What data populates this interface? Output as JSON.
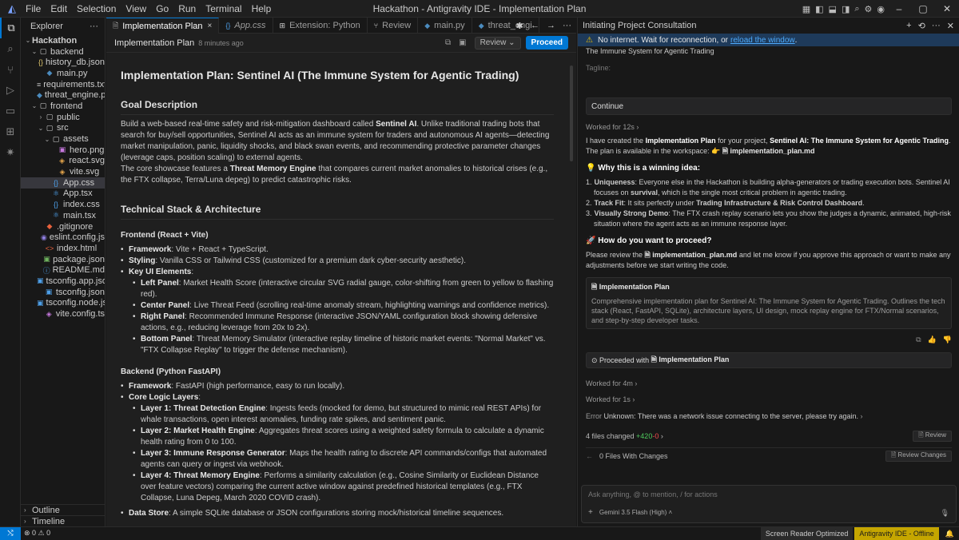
{
  "menu": [
    "File",
    "Edit",
    "Selection",
    "View",
    "Go",
    "Run",
    "Terminal",
    "Help"
  ],
  "window_title": "Hackathon - Antigravity IDE - Implementation Plan",
  "explorer": {
    "title": "Explorer",
    "more": "···",
    "items": [
      {
        "label": "Hackathon",
        "depth": 0,
        "chev": "⌄",
        "icon": "",
        "color": "#cccccc",
        "sel": false,
        "bold": true
      },
      {
        "label": "backend",
        "depth": 1,
        "chev": "⌄",
        "icon": "▢",
        "color": "#cccccc",
        "sel": false
      },
      {
        "label": "history_db.json",
        "depth": 2,
        "chev": "",
        "icon": "{}",
        "color": "#d8c06a",
        "sel": false
      },
      {
        "label": "main.py",
        "depth": 2,
        "chev": "",
        "icon": "◆",
        "color": "#4b8bbe",
        "sel": false
      },
      {
        "label": "requirements.txt",
        "depth": 2,
        "chev": "",
        "icon": "≡",
        "color": "#bbbbbb",
        "sel": false
      },
      {
        "label": "threat_engine.py",
        "depth": 2,
        "chev": "",
        "icon": "◆",
        "color": "#4b8bbe",
        "sel": false
      },
      {
        "label": "frontend",
        "depth": 1,
        "chev": "⌄",
        "icon": "▢",
        "color": "#cccccc",
        "sel": false
      },
      {
        "label": "public",
        "depth": 2,
        "chev": "›",
        "icon": "▢",
        "color": "#cccccc",
        "sel": false
      },
      {
        "label": "src",
        "depth": 2,
        "chev": "⌄",
        "icon": "▢",
        "color": "#cccccc",
        "sel": false
      },
      {
        "label": "assets",
        "depth": 3,
        "chev": "⌄",
        "icon": "▢",
        "color": "#cccccc",
        "sel": false
      },
      {
        "label": "hero.png",
        "depth": 4,
        "chev": "",
        "icon": "▣",
        "color": "#c678dd",
        "sel": false
      },
      {
        "label": "react.svg",
        "depth": 4,
        "chev": "",
        "icon": "◈",
        "color": "#e5a54b",
        "sel": false
      },
      {
        "label": "vite.svg",
        "depth": 4,
        "chev": "",
        "icon": "◈",
        "color": "#e5a54b",
        "sel": false
      },
      {
        "label": "App.css",
        "depth": 3,
        "chev": "",
        "icon": "{}",
        "color": "#4d9fe8",
        "sel": true
      },
      {
        "label": "App.tsx",
        "depth": 3,
        "chev": "",
        "icon": "⚛",
        "color": "#4d9fe8",
        "sel": false
      },
      {
        "label": "index.css",
        "depth": 3,
        "chev": "",
        "icon": "{}",
        "color": "#4d9fe8",
        "sel": false
      },
      {
        "label": "main.tsx",
        "depth": 3,
        "chev": "",
        "icon": "⚛",
        "color": "#4d9fe8",
        "sel": false
      },
      {
        "label": ".gitignore",
        "depth": 2,
        "chev": "",
        "icon": "◆",
        "color": "#e8613c",
        "sel": false
      },
      {
        "label": "eslint.config.js",
        "depth": 2,
        "chev": "",
        "icon": "◉",
        "color": "#8f7fe0",
        "sel": false
      },
      {
        "label": "index.html",
        "depth": 2,
        "chev": "",
        "icon": "<>",
        "color": "#e8613c",
        "sel": false
      },
      {
        "label": "package.json",
        "depth": 2,
        "chev": "",
        "icon": "▣",
        "color": "#6fb35f",
        "sel": false
      },
      {
        "label": "README.md",
        "depth": 2,
        "chev": "",
        "icon": "ⓘ",
        "color": "#4d9fe8",
        "sel": false
      },
      {
        "label": "tsconfig.app.json",
        "depth": 2,
        "chev": "",
        "icon": "▣",
        "color": "#4d9fe8",
        "sel": false
      },
      {
        "label": "tsconfig.json",
        "depth": 2,
        "chev": "",
        "icon": "▣",
        "color": "#4d9fe8",
        "sel": false
      },
      {
        "label": "tsconfig.node.json",
        "depth": 2,
        "chev": "",
        "icon": "▣",
        "color": "#4d9fe8",
        "sel": false
      },
      {
        "label": "vite.config.ts",
        "depth": 2,
        "chev": "",
        "icon": "◈",
        "color": "#c678dd",
        "sel": false
      }
    ],
    "outline": "Outline",
    "timeline": "Timeline"
  },
  "tabs": [
    {
      "label": "Implementation Plan",
      "active": true,
      "close": "×"
    },
    {
      "label": "App.css",
      "active": false,
      "close": ""
    },
    {
      "label": "Extension: Python",
      "active": false,
      "close": ""
    },
    {
      "label": "Review",
      "active": false,
      "close": ""
    },
    {
      "label": "main.py",
      "active": false,
      "close": ""
    },
    {
      "label": "threat_engi",
      "active": false,
      "close": ""
    }
  ],
  "doc_header": {
    "title": "Implementation Plan",
    "time": "8 minutes ago",
    "review": "Review ⌄",
    "proceed": "Proceed"
  },
  "doc": {
    "h1": "Implementation Plan: Sentinel AI (The Immune System for Agentic Trading)",
    "goal_h": "Goal Description",
    "goal_p1_a": "Build a web-based real-time safety and risk-mitigation dashboard called ",
    "goal_p1_b": "Sentinel AI",
    "goal_p1_c": ". Unlike traditional trading bots that search for buy/sell opportunities, Sentinel AI acts as an immune system for traders and autonomous AI agents—detecting market manipulation, panic, liquidity shocks, and black swan events, and recommending protective parameter changes (leverage caps, position scaling) to external agents.",
    "goal_p2_a": "The core showcase features a ",
    "goal_p2_b": "Threat Memory Engine",
    "goal_p2_c": " that compares current market anomalies to historical crises (e.g., the FTX collapse, Terra/Luna depeg) to predict catastrophic risks.",
    "tech_h": "Technical Stack & Architecture",
    "fe_h": "Frontend (React + Vite)",
    "fe_items": [
      {
        "k": "Framework",
        "v": ": Vite + React + TypeScript."
      },
      {
        "k": "Styling",
        "v": ": Vanilla CSS or Tailwind CSS (customized for a premium dark cyber-security aesthetic)."
      },
      {
        "k": "Key UI Elements",
        "v": ":"
      }
    ],
    "ui_items": [
      {
        "k": "Left Panel",
        "v": ": Market Health Score (interactive circular SVG radial gauge, color-shifting from green to yellow to flashing red)."
      },
      {
        "k": "Center Panel",
        "v": ": Live Threat Feed (scrolling real-time anomaly stream, highlighting warnings and confidence metrics)."
      },
      {
        "k": "Right Panel",
        "v": ": Recommended Immune Response (interactive JSON/YAML configuration block showing defensive actions, e.g., reducing leverage from 20x to 2x)."
      },
      {
        "k": "Bottom Panel",
        "v": ": Threat Memory Simulator (interactive replay timeline of historic market events: \"Normal Market\" vs. \"FTX Collapse Replay\" to trigger the defense mechanism)."
      }
    ],
    "be_h": "Backend (Python FastAPI)",
    "be_items": [
      {
        "k": "Framework",
        "v": ": FastAPI (high performance, easy to run locally)."
      },
      {
        "k": "Core Logic Layers",
        "v": ":"
      }
    ],
    "layer_items": [
      {
        "k": "Layer 1: Threat Detection Engine",
        "v": ": Ingests feeds (mocked for demo, but structured to mimic real REST APIs) for whale transactions, open interest anomalies, funding rate spikes, and sentiment panic."
      },
      {
        "k": "Layer 2: Market Health Engine",
        "v": ": Aggregates threat scores using a weighted safety formula to calculate a dynamic health rating from 0 to 100."
      },
      {
        "k": "Layer 3: Immune Response Generator",
        "v": ": Maps the health rating to discrete API commands/configs that automated agents can query or ingest via webhook."
      },
      {
        "k": "Layer 4: Threat Memory Engine",
        "v": ": Performs a similarity calculation (e.g., Cosine Similarity or Euclidean Distance over feature vectors) comparing the current active window against predefined historical templates (e.g., FTX Collapse, Luna Depeg, March 2020 COVID crash)."
      }
    ],
    "ds_k": "Data Store",
    "ds_v": ": A simple SQLite database or JSON configurations storing mock/historical timeline sequences."
  },
  "panel": {
    "title": "Initiating Project Consultation",
    "banner_a": "No internet. Wait for reconnection, or ",
    "banner_link": "reload the window",
    "banner_b": ".",
    "pending_1": "The Immune System for Agentic Trading",
    "pending_2": "Tagline:",
    "continue": "Continue",
    "worked_12": "Worked for 12s  ›",
    "p1_a": "I have created the ",
    "p1_b": "Implementation Plan",
    "p1_c": " for your project, ",
    "p1_d": "Sentinel AI: The Immune System for Agentic Trading",
    "p1_e": ".",
    "p2_a": "The plan is available in the workspace: 👉 ",
    "p2_file": "🗎 implementation_plan.md",
    "why_h": "💡 Why this is a winning idea:",
    "why_items": [
      {
        "n": "1.",
        "k": "Uniqueness",
        "v": ": Everyone else in the Hackathon is building alpha-generators or trading execution bots. Sentinel AI focuses on ",
        "k2": "survival",
        "v2": ", which is the single most critical problem in agentic trading."
      },
      {
        "n": "2.",
        "k": "Track Fit",
        "v": ": It sits perfectly under ",
        "k2": "Trading Infrastructure & Risk Control Dashboard",
        "v2": "."
      },
      {
        "n": "3.",
        "k": "Visually Strong Demo",
        "v": ": The FTX crash replay scenario lets you show the judges a dynamic, animated, high-risk situation where the agent acts as an immune response layer.",
        "k2": "",
        "v2": ""
      }
    ],
    "proceed_h": "🚀 How do you want to proceed?",
    "p3_a": "Please review the ",
    "p3_file": "🗎 implementation_plan.md",
    "p3_b": " and let me know if you approve this approach or want to make any adjustments before we start writing the code.",
    "card_title": "🗎 Implementation Plan",
    "card_desc": "Comprehensive implementation plan for Sentinel AI: The Immune System for Agentic Trading. Outlines the tech stack (React, FastAPI, SQLite), architecture layers, UI design, mock replay engine for FTX/Normal scenarios, and step-by-step developer tasks.",
    "proceeded_a": "⊙ Proceeded with ",
    "proceeded_b": "🗎 Implementation Plan",
    "worked_4m": "Worked for 4m  ›",
    "worked_1s": "Worked for 1s  ›",
    "err_label": "Error ",
    "err_text": "Unknown: There was a network issue connecting to the server, please try again.",
    "err_chev": " ›",
    "changes_a": "4 files changed ",
    "changes_add": "+420",
    "changes_del": "-0",
    "changes_chev": "  ›",
    "review_btn": "🗎 Review",
    "fwc": "0 Files With Changes",
    "fwc_btn": "🗎 Review Changes",
    "input_placeholder": "Ask anything, @ to mention, / for actions",
    "plus": "+",
    "model": "Gemini 3.5 Flash (High)  ˄",
    "mic": "🎙"
  },
  "status": {
    "remote": "⤭",
    "problems": "⊗ 0  ⚠ 0",
    "screen_reader": "Screen Reader Optimized",
    "offline": "Antigravity IDE - Offline",
    "bell": "🔔"
  }
}
